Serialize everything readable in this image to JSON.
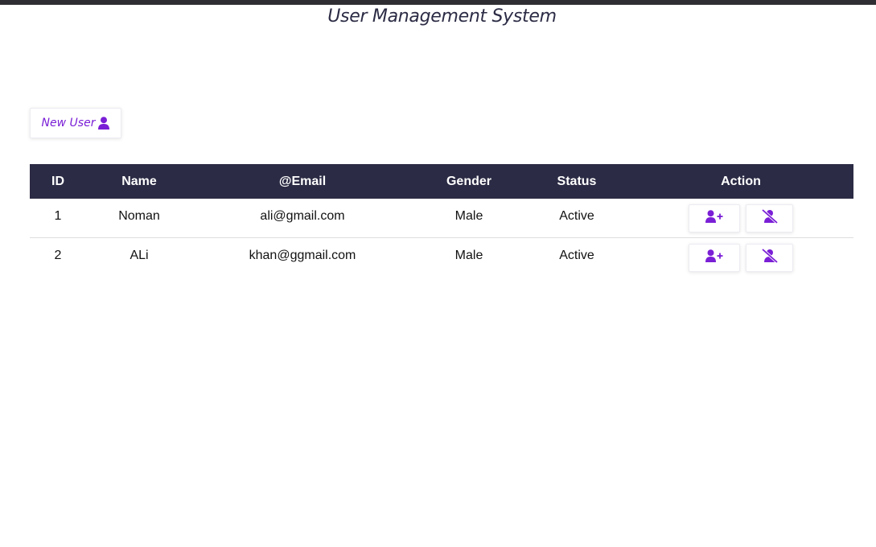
{
  "app": {
    "title": "User Management System"
  },
  "toolbar": {
    "new_user_label": "New User",
    "new_user_icon": "user-icon"
  },
  "colors": {
    "header_bg": "#2b2b45",
    "accent": "#7a1fd6",
    "topbar": "#2f2f33"
  },
  "table": {
    "columns": [
      "ID",
      "Name",
      "@Email",
      "Gender",
      "Status",
      "Action"
    ],
    "rows": [
      {
        "id": "1",
        "name": "Noman",
        "email": "ali@gmail.com",
        "gender": "Male",
        "status": "Active"
      },
      {
        "id": "2",
        "name": "ALi",
        "email": "khan@ggmail.com",
        "gender": "Male",
        "status": "Active"
      }
    ],
    "row_actions": [
      {
        "name": "add-user-button",
        "icon": "user-plus-icon"
      },
      {
        "name": "delete-user-button",
        "icon": "user-slash-icon"
      }
    ]
  }
}
